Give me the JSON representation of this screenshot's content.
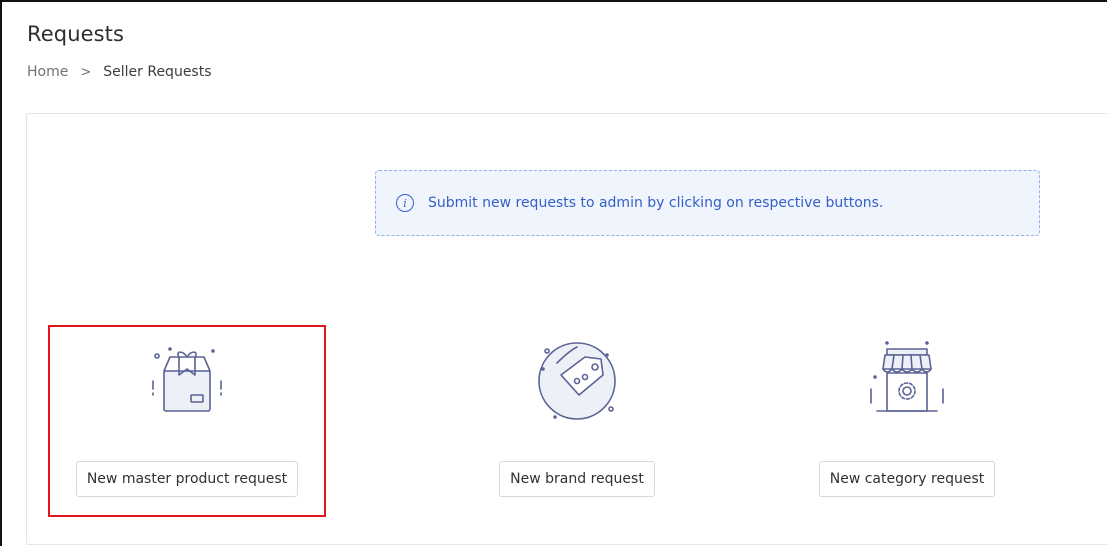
{
  "header": {
    "title": "Requests",
    "breadcrumb": {
      "home": "Home",
      "separator": ">",
      "current": "Seller Requests"
    }
  },
  "info": {
    "icon": "info-icon",
    "glyph": "i",
    "text": "Submit new requests to admin by clicking on respective buttons."
  },
  "options": [
    {
      "icon": "box-icon",
      "label": "New master product request"
    },
    {
      "icon": "tag-icon",
      "label": "New brand request"
    },
    {
      "icon": "store-icon",
      "label": "New category request"
    }
  ],
  "colors": {
    "accent": "#3560c6",
    "info_bg": "#f0f5fd",
    "highlight": "#e0151b",
    "icon_stroke": "#5a6394"
  }
}
